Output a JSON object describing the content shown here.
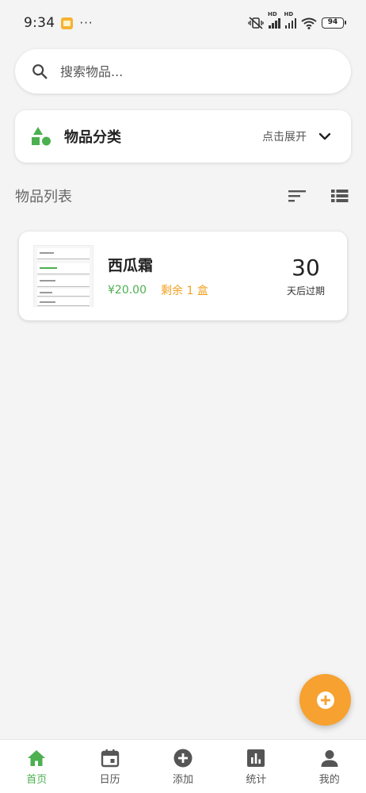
{
  "status_bar": {
    "time": "9:34",
    "dots": "···",
    "battery": "94"
  },
  "search": {
    "placeholder": "搜索物品..."
  },
  "category": {
    "title": "物品分类",
    "expand_label": "点击展开"
  },
  "list": {
    "title": "物品列表"
  },
  "items": [
    {
      "name": "西瓜霜",
      "price": "¥20.00",
      "remaining": "剩余 1 盒",
      "days": "30",
      "days_label": "天后过期"
    }
  ],
  "nav": [
    {
      "label": "首页",
      "icon": "home-icon",
      "active": true
    },
    {
      "label": "日历",
      "icon": "calendar-icon",
      "active": false
    },
    {
      "label": "添加",
      "icon": "add-circle-icon",
      "active": false
    },
    {
      "label": "统计",
      "icon": "bar-chart-icon",
      "active": false
    },
    {
      "label": "我的",
      "icon": "person-icon",
      "active": false
    }
  ],
  "colors": {
    "accent_green": "#4caf50",
    "accent_orange": "#f7a130",
    "remaining_orange": "#f0a020"
  }
}
